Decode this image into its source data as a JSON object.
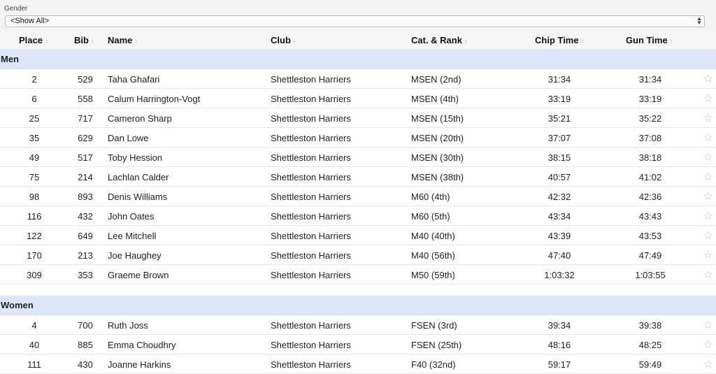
{
  "filter": {
    "label": "Gender",
    "selected": "<Show All>"
  },
  "columns": [
    "Place",
    "Bib",
    "Name",
    "Club",
    "Cat. & Rank",
    "Chip Time",
    "Gun Time"
  ],
  "sort_icon": "↕",
  "star_icon": "☆",
  "groups": [
    {
      "name": "Men",
      "rows": [
        [
          "2",
          "529",
          "Taha Ghafari",
          "Shettleston Harriers",
          "MSEN (2nd)",
          "31:34",
          "31:34"
        ],
        [
          "6",
          "558",
          "Calum Harrington-Vogt",
          "Shettleston Harriers",
          "MSEN (4th)",
          "33:19",
          "33:19"
        ],
        [
          "25",
          "717",
          "Cameron Sharp",
          "Shettleston Harriers",
          "MSEN (15th)",
          "35:21",
          "35:22"
        ],
        [
          "35",
          "629",
          "Dan Lowe",
          "Shettleston Harriers",
          "MSEN (20th)",
          "37:07",
          "37:08"
        ],
        [
          "49",
          "517",
          "Toby Hession",
          "Shettleston Harriers",
          "MSEN (30th)",
          "38:15",
          "38:18"
        ],
        [
          "75",
          "214",
          "Lachlan Calder",
          "Shettleston Harriers",
          "MSEN (38th)",
          "40:57",
          "41:02"
        ],
        [
          "98",
          "893",
          "Denis Williams",
          "Shettleston Harriers",
          "M60 (4th)",
          "42:32",
          "42:36"
        ],
        [
          "116",
          "432",
          "John Oates",
          "Shettleston Harriers",
          "M60 (5th)",
          "43:34",
          "43:43"
        ],
        [
          "122",
          "649",
          "Lee Mitchell",
          "Shettleston Harriers",
          "M40 (40th)",
          "43:39",
          "43:53"
        ],
        [
          "170",
          "213",
          "Joe Haughey",
          "Shettleston Harriers",
          "M40 (56th)",
          "47:40",
          "47:49"
        ],
        [
          "309",
          "353",
          "Graeme Brown",
          "Shettleston Harriers",
          "M50 (59th)",
          "1:03:32",
          "1:03:55"
        ]
      ]
    },
    {
      "name": "Women",
      "rows": [
        [
          "4",
          "700",
          "Ruth Joss",
          "Shettleston Harriers",
          "FSEN (3rd)",
          "39:34",
          "39:38"
        ],
        [
          "40",
          "885",
          "Emma Choudhry",
          "Shettleston Harriers",
          "FSEN (25th)",
          "48:16",
          "48:25"
        ],
        [
          "111",
          "430",
          "Joanne Harkins",
          "Shettleston Harriers",
          "F40 (32nd)",
          "59:17",
          "59:49"
        ]
      ]
    }
  ]
}
